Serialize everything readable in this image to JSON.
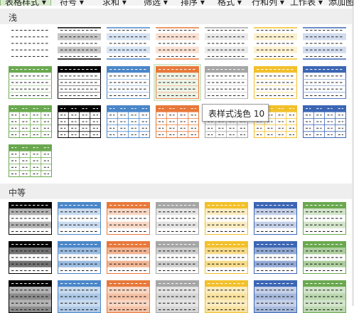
{
  "ribbon": {
    "tabs": [
      "表格样式 ▾",
      "符号 ▾",
      "求和 ▾",
      "筛选 ▾",
      "排序 ▾",
      "格式 ▾",
      "行和列 ▾",
      "工作表 ▾",
      "添加图格"
    ]
  },
  "sections": [
    {
      "label": "浅"
    },
    {
      "label": "中等"
    }
  ],
  "tooltip": {
    "text": "表样式浅色 10"
  },
  "colors": {
    "black": "#000000",
    "gray": "#9e9e9e",
    "blue": "#4a86c8",
    "orange": "#e8783a",
    "silver": "#a6a6a6",
    "gold": "#f2c02a",
    "navy": "#3c66b4",
    "green": "#6aa84f"
  },
  "light_styles": [
    [
      "none",
      "black",
      "blue",
      "orange",
      "silver",
      "gold",
      "navy"
    ],
    [
      "green",
      "black",
      "blue",
      "orange",
      "silver",
      "gold",
      "navy"
    ],
    [
      "green",
      "black",
      "blue",
      "orange",
      "silver",
      "gold",
      "navy"
    ],
    [
      "green"
    ]
  ],
  "medium_styles": [
    [
      "black",
      "blue",
      "orange",
      "silver",
      "gold",
      "navy",
      "green"
    ],
    [
      "black",
      "blue",
      "orange",
      "silver",
      "gold",
      "navy",
      "green"
    ],
    [
      "black",
      "blue",
      "orange",
      "silver",
      "gold",
      "navy",
      "green"
    ]
  ]
}
